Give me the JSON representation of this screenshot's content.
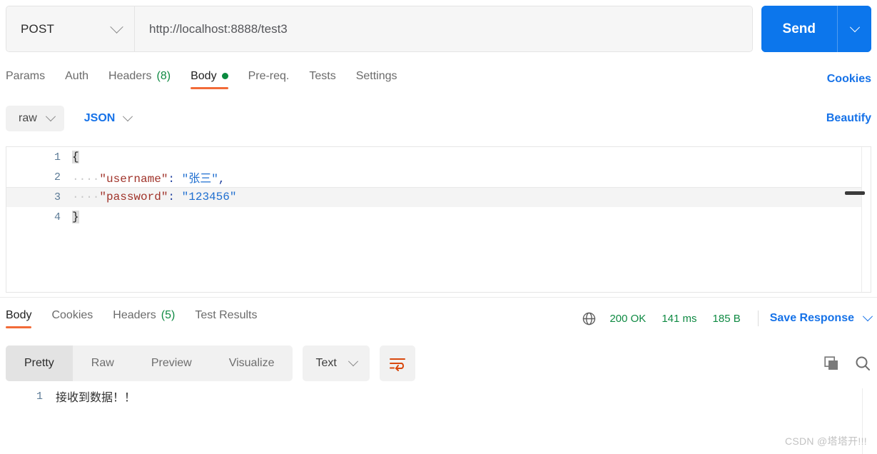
{
  "request": {
    "method": "POST",
    "url": "http://localhost:8888/test3",
    "send_label": "Send",
    "tabs": [
      {
        "label": "Params",
        "count": "",
        "active": false,
        "dot": false
      },
      {
        "label": "Auth",
        "count": "",
        "active": false,
        "dot": false
      },
      {
        "label": "Headers",
        "count": "(8)",
        "active": false,
        "dot": false
      },
      {
        "label": "Body",
        "count": "",
        "active": true,
        "dot": true
      },
      {
        "label": "Pre-req.",
        "count": "",
        "active": false,
        "dot": false
      },
      {
        "label": "Tests",
        "count": "",
        "active": false,
        "dot": false
      },
      {
        "label": "Settings",
        "count": "",
        "active": false,
        "dot": false
      }
    ],
    "cookies_link": "Cookies",
    "body_mode": "raw",
    "body_format": "JSON",
    "beautify_link": "Beautify"
  },
  "editor": {
    "lines": [
      {
        "n": "1",
        "indent": "",
        "key": "",
        "colon": "",
        "value": "",
        "comma": "",
        "brace": "{",
        "highlight": false
      },
      {
        "n": "2",
        "indent": "····",
        "key": "\"username\"",
        "colon": ":",
        "value": "\"张三\"",
        "comma": ",",
        "brace": "",
        "highlight": false
      },
      {
        "n": "3",
        "indent": "····",
        "key": "\"password\"",
        "colon": ":",
        "value": "\"123456\"",
        "comma": "",
        "brace": "",
        "highlight": true
      },
      {
        "n": "4",
        "indent": "",
        "key": "",
        "colon": "",
        "value": "",
        "comma": "",
        "brace": "}",
        "highlight": false
      }
    ]
  },
  "response": {
    "tabs": [
      {
        "label": "Body",
        "count": "",
        "active": true
      },
      {
        "label": "Cookies",
        "count": "",
        "active": false
      },
      {
        "label": "Headers",
        "count": "(5)",
        "active": false
      },
      {
        "label": "Test Results",
        "count": "",
        "active": false
      }
    ],
    "status": "200 OK",
    "time": "141 ms",
    "size": "185 B",
    "save_label": "Save Response",
    "view_tabs": [
      {
        "label": "Pretty",
        "active": true
      },
      {
        "label": "Raw",
        "active": false
      },
      {
        "label": "Preview",
        "active": false
      },
      {
        "label": "Visualize",
        "active": false
      }
    ],
    "format": "Text",
    "body_lines": [
      {
        "n": "1",
        "text": "接收到数据！！"
      }
    ]
  },
  "colors": {
    "accent_blue": "#0c76ec",
    "link_blue": "#1672e8",
    "active_orange": "#f26b38",
    "status_green": "#0f8a43",
    "wrap_orange": "#d9490f"
  },
  "watermark": "CSDN @塔塔开!!!"
}
